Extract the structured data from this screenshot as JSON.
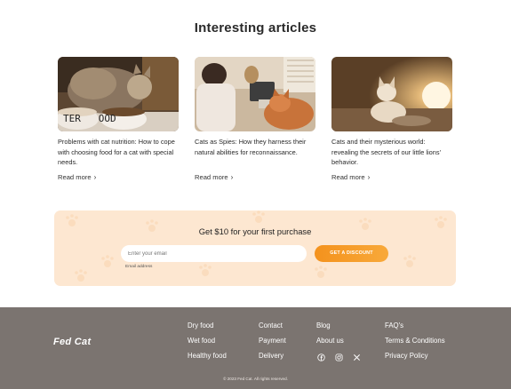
{
  "articles": {
    "title": "Interesting articles",
    "items": [
      {
        "description": "Problems with cat nutrition: How to cope with choosing food for a cat with special needs.",
        "read_more": "Read more",
        "bowl_text": "TER   OOD"
      },
      {
        "description": "Cats as Spies: How they harness their natural abilities for reconnaissance.",
        "read_more": "Read more"
      },
      {
        "description": "Cats and their mysterious world: revealing the secrets of our little lions' behavior.",
        "read_more": "Read more"
      }
    ]
  },
  "promo": {
    "title": "Get $10 for your first purchase",
    "email_placeholder": "Enter your email",
    "email_label": "Email address",
    "cta": "GET A DISCOUNT"
  },
  "footer": {
    "logo": "Fed Cat",
    "col1": [
      "Dry food",
      "Wet food",
      "Healthy food"
    ],
    "col2": [
      "Contact",
      "Payment",
      "Delivery"
    ],
    "col3": [
      "Blog",
      "About us"
    ],
    "col4": [
      "FAQ's",
      "Terms & Conditions",
      "Privacy Policy"
    ],
    "social_icons": [
      "facebook-icon",
      "instagram-icon",
      "x-icon"
    ],
    "copyright": "© 2023 Fed Cat. All rights reserved."
  },
  "colors": {
    "promo_bg": "#fde7d1",
    "cta_orange": "#f4921d",
    "footer_bg": "#7b7470"
  }
}
